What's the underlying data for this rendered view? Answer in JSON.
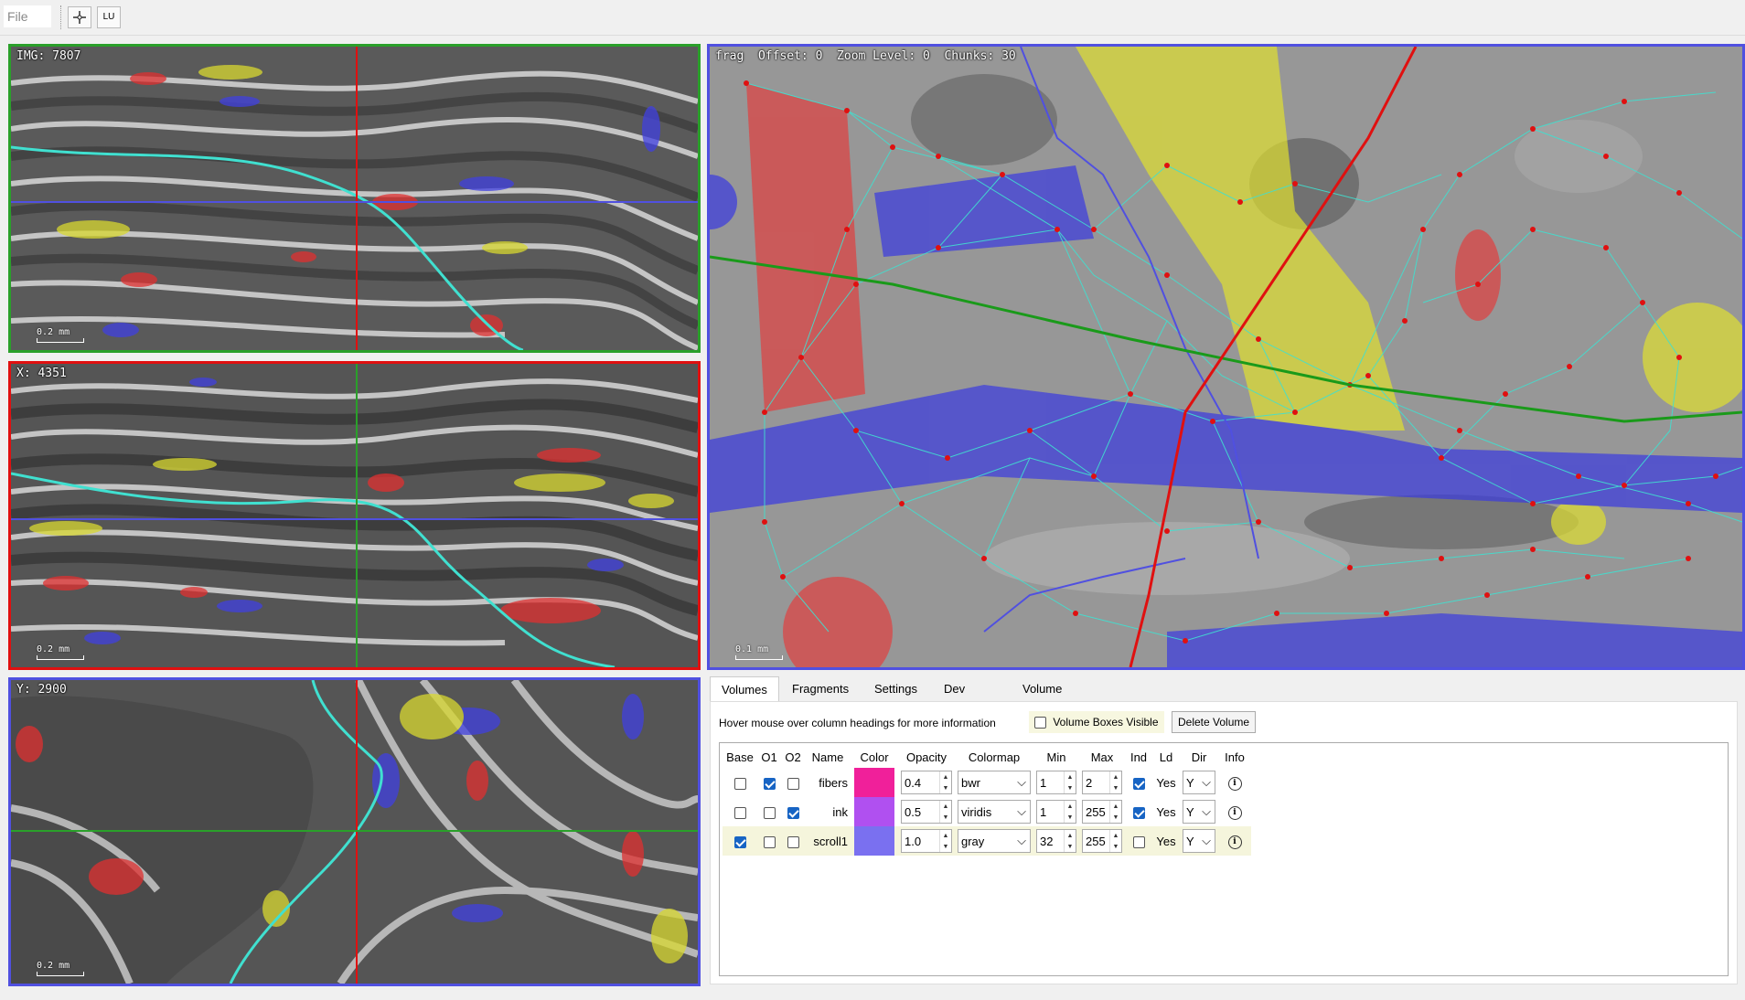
{
  "toolbar": {
    "file_label": "File",
    "lu_label": "LU"
  },
  "viewers": {
    "img": {
      "label": "IMG: 7807",
      "scale": "0.2 mm",
      "border": "#2aa02a"
    },
    "x": {
      "label": "X: 4351",
      "scale": "0.2 mm",
      "border": "#e01010"
    },
    "y": {
      "label": "Y: 2900",
      "scale": "0.2 mm",
      "border": "#5050e0"
    },
    "frag": {
      "label": "frag  Offset: 0  Zoom Level: 0  Chunks: 30",
      "scale": "0.1 mm",
      "border": "#5050e0"
    }
  },
  "tabs": [
    "Volumes",
    "Fragments",
    "Settings",
    "Dev Tools",
    "Volume Segmentation"
  ],
  "volumes_panel": {
    "hint": "Hover mouse over column headings for more information",
    "boxes_visible_label": "Volume Boxes Visible",
    "delete_label": "Delete Volume",
    "columns": [
      "Base",
      "O1",
      "O2",
      "Name",
      "Color",
      "Opacity",
      "Colormap",
      "Min",
      "Max",
      "Ind",
      "Ld",
      "Dir",
      "Info"
    ],
    "rows": [
      {
        "base": false,
        "o1": true,
        "o2": false,
        "name": "fibers",
        "color": "#f0209a",
        "opacity": "0.4",
        "colormap": "bwr",
        "min": "1",
        "max": "2",
        "ind": true,
        "ld": "Yes",
        "dir": "Y"
      },
      {
        "base": false,
        "o1": false,
        "o2": true,
        "name": "ink",
        "color": "#b050f0",
        "opacity": "0.5",
        "colormap": "viridis",
        "min": "1",
        "max": "255",
        "ind": true,
        "ld": "Yes",
        "dir": "Y"
      },
      {
        "base": true,
        "o1": false,
        "o2": false,
        "name": "scroll1",
        "color": "#7a70f0",
        "opacity": "1.0",
        "colormap": "gray",
        "min": "32",
        "max": "255",
        "ind": false,
        "ld": "Yes",
        "dir": "Y"
      }
    ]
  }
}
